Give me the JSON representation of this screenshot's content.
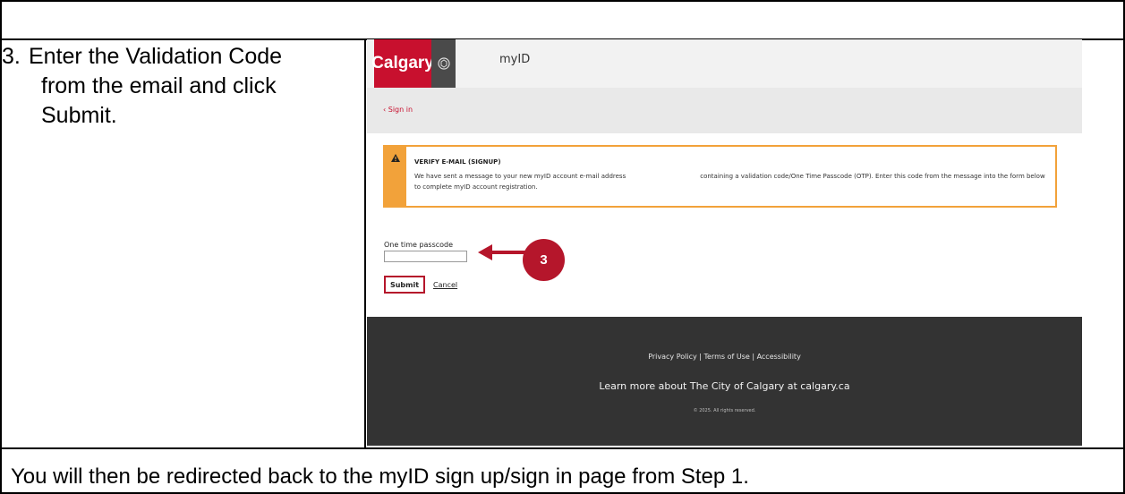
{
  "step": {
    "number": "3.",
    "line1": "Enter the Validation Code",
    "line2": "from the email and click",
    "line3": "Submit."
  },
  "note": "You will then be redirected back to the myID sign up/sign in page from Step 1.",
  "screenshot": {
    "header": {
      "logo_text": "Calgary",
      "app_name": "myID"
    },
    "breadcrumb": {
      "signin_link": "‹  Sign in"
    },
    "alert": {
      "title": "VERIFY E-MAIL (SIGNUP)",
      "body_part1": "We have sent a message to your new myID account e-mail address",
      "body_part2": "containing a validation code/One Time Passcode (OTP). Enter this code from the message into the form below to complete myID account registration.",
      "icon": "warning-icon"
    },
    "form": {
      "otp_label": "One time passcode",
      "otp_value": "",
      "submit_label": "Submit",
      "cancel_label": "Cancel"
    },
    "callout": {
      "number": "3"
    },
    "footer": {
      "links": "Privacy Policy | Terms of Use | Accessibility",
      "learn_more": "Learn more about The City of Calgary at calgary.ca",
      "copyright": "© 2025. All rights reserved."
    }
  },
  "colors": {
    "brand_red": "#c8102e",
    "alert_orange": "#f2a23a",
    "footer_dark": "#333333"
  }
}
